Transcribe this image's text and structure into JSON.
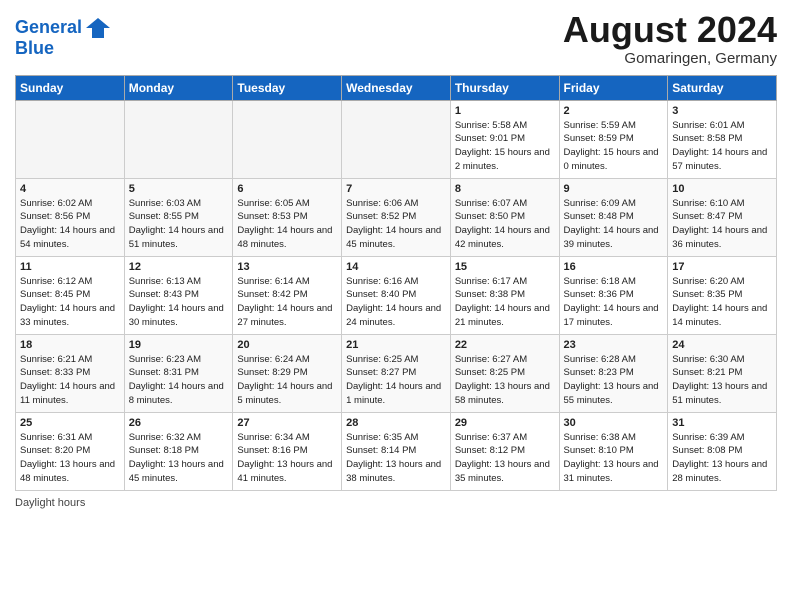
{
  "header": {
    "logo_line1": "General",
    "logo_line2": "Blue",
    "month_title": "August 2024",
    "location": "Gomaringen, Germany"
  },
  "days_of_week": [
    "Sunday",
    "Monday",
    "Tuesday",
    "Wednesday",
    "Thursday",
    "Friday",
    "Saturday"
  ],
  "weeks": [
    [
      {
        "num": "",
        "sunrise": "",
        "sunset": "",
        "daylight": "",
        "empty": true
      },
      {
        "num": "",
        "sunrise": "",
        "sunset": "",
        "daylight": "",
        "empty": true
      },
      {
        "num": "",
        "sunrise": "",
        "sunset": "",
        "daylight": "",
        "empty": true
      },
      {
        "num": "",
        "sunrise": "",
        "sunset": "",
        "daylight": "",
        "empty": true
      },
      {
        "num": "1",
        "sunrise": "Sunrise: 5:58 AM",
        "sunset": "Sunset: 9:01 PM",
        "daylight": "Daylight: 15 hours and 2 minutes."
      },
      {
        "num": "2",
        "sunrise": "Sunrise: 5:59 AM",
        "sunset": "Sunset: 8:59 PM",
        "daylight": "Daylight: 15 hours and 0 minutes."
      },
      {
        "num": "3",
        "sunrise": "Sunrise: 6:01 AM",
        "sunset": "Sunset: 8:58 PM",
        "daylight": "Daylight: 14 hours and 57 minutes."
      }
    ],
    [
      {
        "num": "4",
        "sunrise": "Sunrise: 6:02 AM",
        "sunset": "Sunset: 8:56 PM",
        "daylight": "Daylight: 14 hours and 54 minutes."
      },
      {
        "num": "5",
        "sunrise": "Sunrise: 6:03 AM",
        "sunset": "Sunset: 8:55 PM",
        "daylight": "Daylight: 14 hours and 51 minutes."
      },
      {
        "num": "6",
        "sunrise": "Sunrise: 6:05 AM",
        "sunset": "Sunset: 8:53 PM",
        "daylight": "Daylight: 14 hours and 48 minutes."
      },
      {
        "num": "7",
        "sunrise": "Sunrise: 6:06 AM",
        "sunset": "Sunset: 8:52 PM",
        "daylight": "Daylight: 14 hours and 45 minutes."
      },
      {
        "num": "8",
        "sunrise": "Sunrise: 6:07 AM",
        "sunset": "Sunset: 8:50 PM",
        "daylight": "Daylight: 14 hours and 42 minutes."
      },
      {
        "num": "9",
        "sunrise": "Sunrise: 6:09 AM",
        "sunset": "Sunset: 8:48 PM",
        "daylight": "Daylight: 14 hours and 39 minutes."
      },
      {
        "num": "10",
        "sunrise": "Sunrise: 6:10 AM",
        "sunset": "Sunset: 8:47 PM",
        "daylight": "Daylight: 14 hours and 36 minutes."
      }
    ],
    [
      {
        "num": "11",
        "sunrise": "Sunrise: 6:12 AM",
        "sunset": "Sunset: 8:45 PM",
        "daylight": "Daylight: 14 hours and 33 minutes."
      },
      {
        "num": "12",
        "sunrise": "Sunrise: 6:13 AM",
        "sunset": "Sunset: 8:43 PM",
        "daylight": "Daylight: 14 hours and 30 minutes."
      },
      {
        "num": "13",
        "sunrise": "Sunrise: 6:14 AM",
        "sunset": "Sunset: 8:42 PM",
        "daylight": "Daylight: 14 hours and 27 minutes."
      },
      {
        "num": "14",
        "sunrise": "Sunrise: 6:16 AM",
        "sunset": "Sunset: 8:40 PM",
        "daylight": "Daylight: 14 hours and 24 minutes."
      },
      {
        "num": "15",
        "sunrise": "Sunrise: 6:17 AM",
        "sunset": "Sunset: 8:38 PM",
        "daylight": "Daylight: 14 hours and 21 minutes."
      },
      {
        "num": "16",
        "sunrise": "Sunrise: 6:18 AM",
        "sunset": "Sunset: 8:36 PM",
        "daylight": "Daylight: 14 hours and 17 minutes."
      },
      {
        "num": "17",
        "sunrise": "Sunrise: 6:20 AM",
        "sunset": "Sunset: 8:35 PM",
        "daylight": "Daylight: 14 hours and 14 minutes."
      }
    ],
    [
      {
        "num": "18",
        "sunrise": "Sunrise: 6:21 AM",
        "sunset": "Sunset: 8:33 PM",
        "daylight": "Daylight: 14 hours and 11 minutes."
      },
      {
        "num": "19",
        "sunrise": "Sunrise: 6:23 AM",
        "sunset": "Sunset: 8:31 PM",
        "daylight": "Daylight: 14 hours and 8 minutes."
      },
      {
        "num": "20",
        "sunrise": "Sunrise: 6:24 AM",
        "sunset": "Sunset: 8:29 PM",
        "daylight": "Daylight: 14 hours and 5 minutes."
      },
      {
        "num": "21",
        "sunrise": "Sunrise: 6:25 AM",
        "sunset": "Sunset: 8:27 PM",
        "daylight": "Daylight: 14 hours and 1 minute."
      },
      {
        "num": "22",
        "sunrise": "Sunrise: 6:27 AM",
        "sunset": "Sunset: 8:25 PM",
        "daylight": "Daylight: 13 hours and 58 minutes."
      },
      {
        "num": "23",
        "sunrise": "Sunrise: 6:28 AM",
        "sunset": "Sunset: 8:23 PM",
        "daylight": "Daylight: 13 hours and 55 minutes."
      },
      {
        "num": "24",
        "sunrise": "Sunrise: 6:30 AM",
        "sunset": "Sunset: 8:21 PM",
        "daylight": "Daylight: 13 hours and 51 minutes."
      }
    ],
    [
      {
        "num": "25",
        "sunrise": "Sunrise: 6:31 AM",
        "sunset": "Sunset: 8:20 PM",
        "daylight": "Daylight: 13 hours and 48 minutes."
      },
      {
        "num": "26",
        "sunrise": "Sunrise: 6:32 AM",
        "sunset": "Sunset: 8:18 PM",
        "daylight": "Daylight: 13 hours and 45 minutes."
      },
      {
        "num": "27",
        "sunrise": "Sunrise: 6:34 AM",
        "sunset": "Sunset: 8:16 PM",
        "daylight": "Daylight: 13 hours and 41 minutes."
      },
      {
        "num": "28",
        "sunrise": "Sunrise: 6:35 AM",
        "sunset": "Sunset: 8:14 PM",
        "daylight": "Daylight: 13 hours and 38 minutes."
      },
      {
        "num": "29",
        "sunrise": "Sunrise: 6:37 AM",
        "sunset": "Sunset: 8:12 PM",
        "daylight": "Daylight: 13 hours and 35 minutes."
      },
      {
        "num": "30",
        "sunrise": "Sunrise: 6:38 AM",
        "sunset": "Sunset: 8:10 PM",
        "daylight": "Daylight: 13 hours and 31 minutes."
      },
      {
        "num": "31",
        "sunrise": "Sunrise: 6:39 AM",
        "sunset": "Sunset: 8:08 PM",
        "daylight": "Daylight: 13 hours and 28 minutes."
      }
    ]
  ],
  "footer": {
    "label": "Daylight hours"
  }
}
